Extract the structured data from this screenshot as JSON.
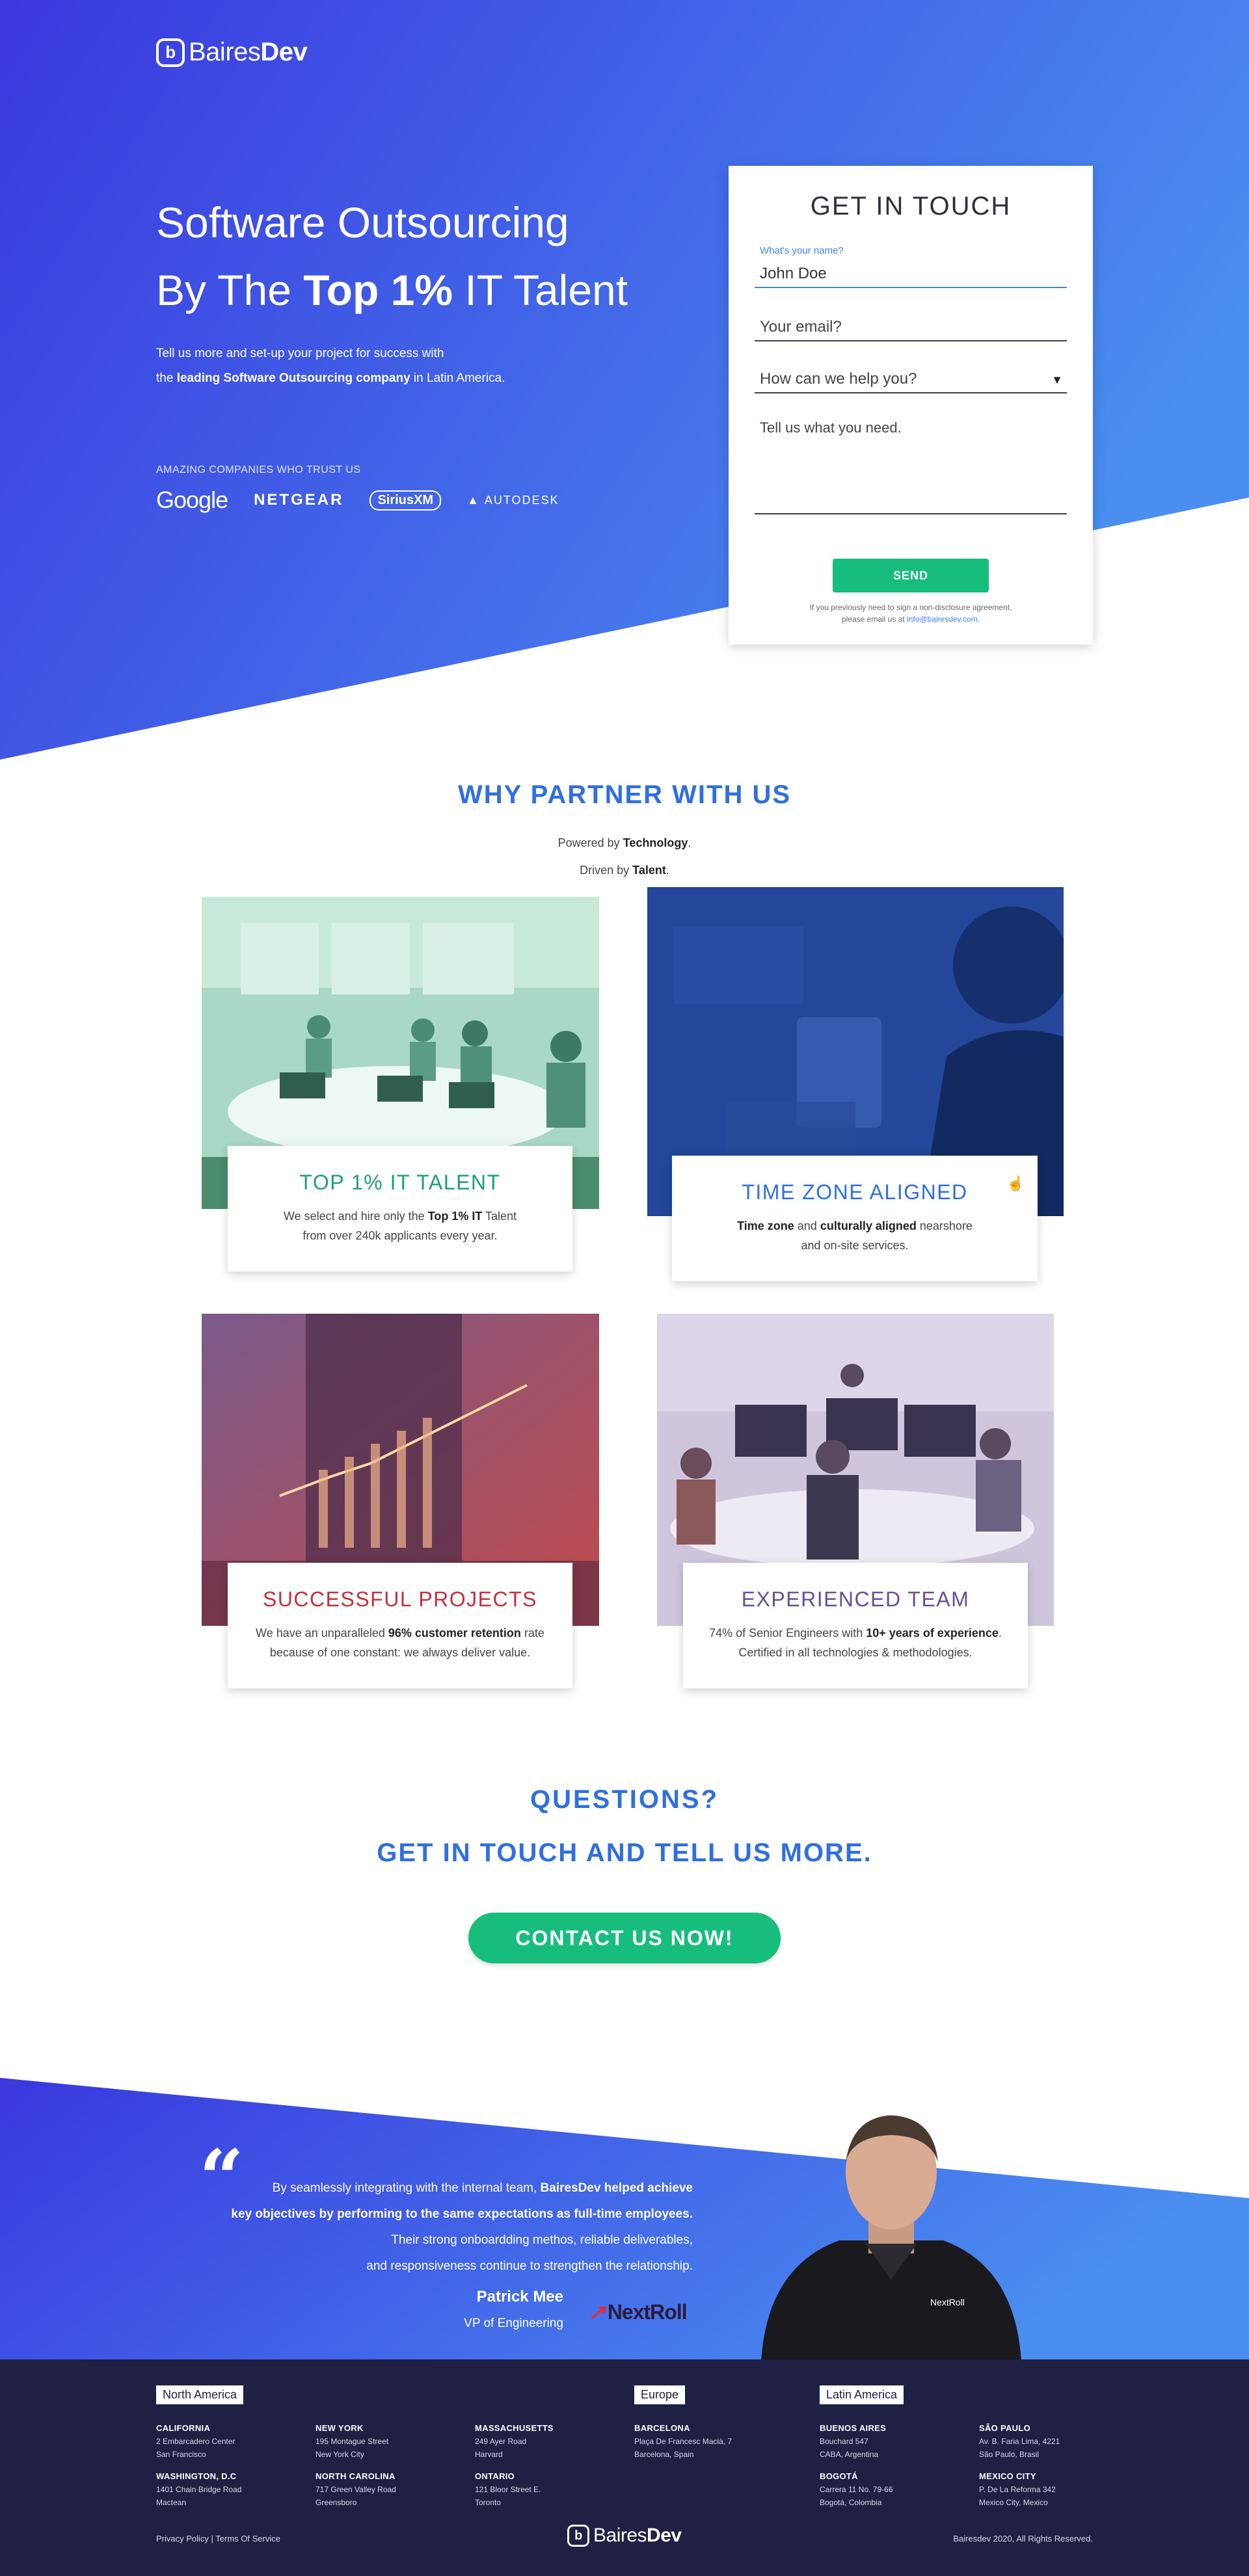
{
  "brand": {
    "name_light": "Baires",
    "name_bold": "Dev"
  },
  "hero": {
    "title_line1": "Software Outsourcing",
    "title_line2_pre": "By The ",
    "title_line2_bold": "Top 1%",
    "title_line2_post": " IT Talent",
    "text_line1": "Tell us more and set-up your project for success with",
    "text_line2_pre": "the ",
    "text_line2_bold": "leading Software Outsourcing company",
    "text_line2_post": " in Latin America.",
    "trust_label": "AMAZING COMPANIES WHO TRUST US",
    "trust_logos": [
      "Google",
      "NETGEAR",
      "SiriusXM",
      "AUTODESK"
    ]
  },
  "form": {
    "title": "GET IN TOUCH",
    "name_label": "What's your name?",
    "name_value": "John Doe",
    "email_placeholder": "Your email?",
    "help_placeholder": "How can we help you?",
    "message_placeholder": "Tell us what you need.",
    "send_label": "SEND",
    "nda_line1": "If you previously need to sign a non-disclosure agreement,",
    "nda_line2_pre": "please email us at ",
    "nda_email": "info@bairesdev.com",
    "nda_line2_post": "."
  },
  "why": {
    "title": "WHY PARTNER WITH US",
    "sub1_pre": "Powered by ",
    "sub1_bold": "Technology",
    "sub1_post": ".",
    "sub2_pre": "Driven by ",
    "sub2_bold": "Talent",
    "sub2_post": ".",
    "cards": [
      {
        "title": "TOP 1% IT TALENT",
        "color": "#1e9e78",
        "l1_pre": "We select and hire only the ",
        "l1_bold": "Top 1% IT",
        "l1_post": " Talent",
        "l2": "from over 240k applicants every year."
      },
      {
        "title": "TIME ZONE ALIGNED",
        "color": "#2f6fe0",
        "l1_bold1": "Time zone",
        "l1_mid": " and ",
        "l1_bold2": "culturally aligned",
        "l1_post": " nearshore",
        "l2": "and on-site services."
      },
      {
        "title": "SUCCESSFUL PROJECTS",
        "color": "#c2303a",
        "l1_pre": "We have an unparalleled ",
        "l1_bold": "96% customer retention",
        "l1_post": " rate",
        "l2": "because of one constant: we always deliver value."
      },
      {
        "title": "EXPERIENCED TEAM",
        "color": "#6b4c9a",
        "l1_pre": "74% of Senior Engineers with ",
        "l1_bold": "10+ years of experience",
        "l1_post": ".",
        "l2": "Certified in all technologies & methodologies."
      }
    ]
  },
  "questions": {
    "line1": "QUESTIONS?",
    "line2": "GET IN TOUCH AND TELL US MORE.",
    "button": "CONTACT US NOW!"
  },
  "testimonial": {
    "quote_mark": "“",
    "l1_pre": "By seamlessly integrating with the internal team, ",
    "l1_bold": "BairesDev helped achieve",
    "l2_bold": "key objectives by performing to the same expectations as full-time employees.",
    "l3": "Their strong onboardding methos, reliable deliverables,",
    "l4": "and responsiveness continue to strengthen the relationship.",
    "name": "Patrick Mee",
    "role": "VP of Engineering",
    "company": "NextRoll"
  },
  "footer": {
    "regions": [
      "North America",
      "Europe",
      "Latin America"
    ],
    "offices": [
      {
        "city": "CALIFORNIA",
        "l1": "2 Embarcadero Center",
        "l2": "San Francisco"
      },
      {
        "city": "NEW YORK",
        "l1": "195 Montague Street",
        "l2": "New York City"
      },
      {
        "city": "MASSACHUSETTS",
        "l1": "249 Ayer Road",
        "l2": "Harvard"
      },
      {
        "city": "WASHINGTON, D.C",
        "l1": "1401 Chain Bridge Road",
        "l2": "Mactean"
      },
      {
        "city": "NORTH CAROLINA",
        "l1": "717 Green Valley Road",
        "l2": "Greensboro"
      },
      {
        "city": "ONTARIO",
        "l1": "121 Bloor Street E.",
        "l2": "Toronto"
      },
      {
        "city": "BARCELONA",
        "l1": "Plaça De Francesc Macià, 7",
        "l2": "Barcelona, Spain"
      },
      {
        "city": "BUENOS AIRES",
        "l1": "Bouchard 547",
        "l2": "CABA, Argentina"
      },
      {
        "city": "SÃO PAULO",
        "l1": "Av. B. Faria Lima, 4221",
        "l2": "São Paulo, Brasil"
      },
      {
        "city": "BOGOTÁ",
        "l1": "Carrera 11 No. 79-66",
        "l2": "Bogotá, Colombia"
      },
      {
        "city": "MEXICO CITY",
        "l1": "P. De La Reforma 342",
        "l2": "Mexico City, Mexico"
      }
    ],
    "privacy": "Privacy Policy",
    "sep": " | ",
    "terms": "Terms Of Service",
    "copyright": "Bairesdev 2020,  All Rights Reserved."
  },
  "colors": {
    "blue_start": "#3b3be0",
    "blue_end": "#4a8ef0",
    "green": "#17bd7c",
    "footer": "#1f2044"
  }
}
